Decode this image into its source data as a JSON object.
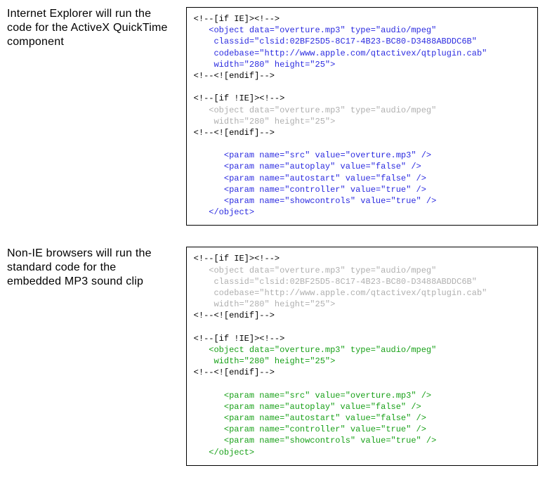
{
  "rows": [
    {
      "caption": "Internet Explorer will run the code for the ActiveX QuickTime component",
      "lines": [
        {
          "cls": "c-black",
          "text": "<!--[if IE]><!-->"
        },
        {
          "cls": "c-blue",
          "text": "   <object data=\"overture.mp3\" type=\"audio/mpeg\""
        },
        {
          "cls": "c-blue",
          "text": "    classid=\"clsid:02BF25D5-8C17-4B23-BC80-D3488ABDDC6B\""
        },
        {
          "cls": "c-blue",
          "text": "    codebase=\"http://www.apple.com/qtactivex/qtplugin.cab\""
        },
        {
          "cls": "c-blue",
          "text": "    width=\"280\" height=\"25\">"
        },
        {
          "cls": "c-black",
          "text": "<!--<![endif]-->"
        },
        {
          "cls": "c-black",
          "text": ""
        },
        {
          "cls": "c-black",
          "text": "<!--[if !IE]><!-->"
        },
        {
          "cls": "c-grey",
          "text": "   <object data=\"overture.mp3\" type=\"audio/mpeg\""
        },
        {
          "cls": "c-grey",
          "text": "    width=\"280\" height=\"25\">"
        },
        {
          "cls": "c-black",
          "text": "<!--<![endif]-->"
        },
        {
          "cls": "c-black",
          "text": ""
        },
        {
          "cls": "c-blue",
          "text": "      <param name=\"src\" value=\"overture.mp3\" />"
        },
        {
          "cls": "c-blue",
          "text": "      <param name=\"autoplay\" value=\"false\" />"
        },
        {
          "cls": "c-blue",
          "text": "      <param name=\"autostart\" value=\"false\" />"
        },
        {
          "cls": "c-blue",
          "text": "      <param name=\"controller\" value=\"true\" />"
        },
        {
          "cls": "c-blue",
          "text": "      <param name=\"showcontrols\" value=\"true\" />"
        },
        {
          "cls": "c-blue",
          "text": "   </object>"
        }
      ]
    },
    {
      "caption": "Non-IE browsers will run the standard code for the embedded MP3 sound clip",
      "lines": [
        {
          "cls": "c-black",
          "text": "<!--[if IE]><!-->"
        },
        {
          "cls": "c-grey",
          "text": "   <object data=\"overture.mp3\" type=\"audio/mpeg\""
        },
        {
          "cls": "c-grey",
          "text": "    classid=\"clsid:02BF25D5-8C17-4B23-BC80-D3488ABDDC6B\""
        },
        {
          "cls": "c-grey",
          "text": "    codebase=\"http://www.apple.com/qtactivex/qtplugin.cab\""
        },
        {
          "cls": "c-grey",
          "text": "    width=\"280\" height=\"25\">"
        },
        {
          "cls": "c-black",
          "text": "<!--<![endif]-->"
        },
        {
          "cls": "c-black",
          "text": ""
        },
        {
          "cls": "c-black",
          "text": "<!--[if !IE]><!-->"
        },
        {
          "cls": "c-green",
          "text": "   <object data=\"overture.mp3\" type=\"audio/mpeg\""
        },
        {
          "cls": "c-green",
          "text": "    width=\"280\" height=\"25\">"
        },
        {
          "cls": "c-black",
          "text": "<!--<![endif]-->"
        },
        {
          "cls": "c-black",
          "text": ""
        },
        {
          "cls": "c-green",
          "text": "      <param name=\"src\" value=\"overture.mp3\" />"
        },
        {
          "cls": "c-green",
          "text": "      <param name=\"autoplay\" value=\"false\" />"
        },
        {
          "cls": "c-green",
          "text": "      <param name=\"autostart\" value=\"false\" />"
        },
        {
          "cls": "c-green",
          "text": "      <param name=\"controller\" value=\"true\" />"
        },
        {
          "cls": "c-green",
          "text": "      <param name=\"showcontrols\" value=\"true\" />"
        },
        {
          "cls": "c-green",
          "text": "   </object>"
        }
      ]
    }
  ]
}
